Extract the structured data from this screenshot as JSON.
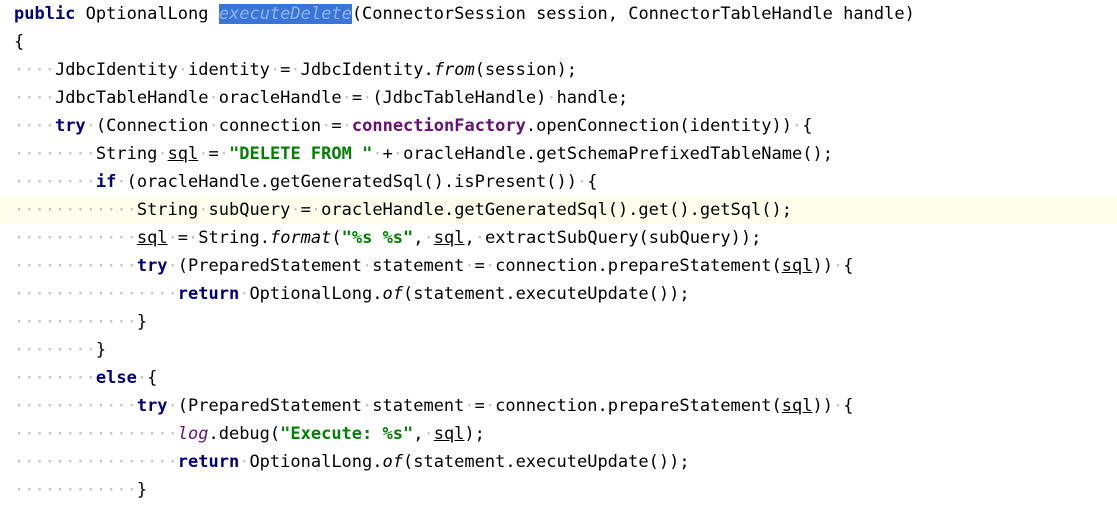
{
  "editor": {
    "language": "java",
    "selected_token": "executeDelete",
    "current_line_index": 7,
    "colors": {
      "background": "#ffffff",
      "keyword": "#000080",
      "string": "#008000",
      "field": "#660e7a",
      "whitespace_dot": "#c2c2c2",
      "selection": "#3875d7",
      "current_line": "#fefdeb"
    },
    "lines": [
      [
        {
          "t": "public",
          "c": "kw"
        },
        {
          "t": " ",
          "c": "ws-space"
        },
        {
          "t": "OptionalLong",
          "c": ""
        },
        {
          "t": " ",
          "c": "ws-space"
        },
        {
          "t": "executeDelete",
          "c": "sel-method"
        },
        {
          "t": "(ConnectorSession",
          "c": ""
        },
        {
          "t": " ",
          "c": "ws-space"
        },
        {
          "t": "session,",
          "c": ""
        },
        {
          "t": " ",
          "c": "ws-space"
        },
        {
          "t": "ConnectorTableHandle",
          "c": ""
        },
        {
          "t": " ",
          "c": "ws-space"
        },
        {
          "t": "handle)",
          "c": ""
        }
      ],
      [
        {
          "t": "{",
          "c": ""
        }
      ],
      [
        {
          "t": "····",
          "c": "ws"
        },
        {
          "t": "JdbcIdentity",
          "c": ""
        },
        {
          "t": "·",
          "c": "ws"
        },
        {
          "t": "identity",
          "c": ""
        },
        {
          "t": "·",
          "c": "ws"
        },
        {
          "t": "=",
          "c": ""
        },
        {
          "t": "·",
          "c": "ws"
        },
        {
          "t": "JdbcIdentity.",
          "c": ""
        },
        {
          "t": "from",
          "c": "static-call"
        },
        {
          "t": "(session);",
          "c": ""
        }
      ],
      [
        {
          "t": "····",
          "c": "ws"
        },
        {
          "t": "JdbcTableHandle",
          "c": ""
        },
        {
          "t": "·",
          "c": "ws"
        },
        {
          "t": "oracleHandle",
          "c": ""
        },
        {
          "t": "·",
          "c": "ws"
        },
        {
          "t": "=",
          "c": ""
        },
        {
          "t": "·",
          "c": "ws"
        },
        {
          "t": "(JdbcTableHandle)",
          "c": ""
        },
        {
          "t": "·",
          "c": "ws"
        },
        {
          "t": "handle;",
          "c": ""
        }
      ],
      [
        {
          "t": "····",
          "c": "ws"
        },
        {
          "t": "try",
          "c": "kw"
        },
        {
          "t": "·",
          "c": "ws"
        },
        {
          "t": "(Connection",
          "c": ""
        },
        {
          "t": "·",
          "c": "ws"
        },
        {
          "t": "connection",
          "c": ""
        },
        {
          "t": "·",
          "c": "ws"
        },
        {
          "t": "=",
          "c": ""
        },
        {
          "t": "·",
          "c": "ws"
        },
        {
          "t": "connectionFactory",
          "c": "field"
        },
        {
          "t": ".openConnection(identity))",
          "c": ""
        },
        {
          "t": "·",
          "c": "ws"
        },
        {
          "t": "{",
          "c": ""
        }
      ],
      [
        {
          "t": "········",
          "c": "ws"
        },
        {
          "t": "String",
          "c": ""
        },
        {
          "t": "·",
          "c": "ws"
        },
        {
          "t": "sql",
          "c": "ul"
        },
        {
          "t": "·",
          "c": "ws"
        },
        {
          "t": "=",
          "c": ""
        },
        {
          "t": "·",
          "c": "ws"
        },
        {
          "t": "\"DELETE FROM \"",
          "c": "str"
        },
        {
          "t": "·",
          "c": "ws"
        },
        {
          "t": "+",
          "c": ""
        },
        {
          "t": "·",
          "c": "ws"
        },
        {
          "t": "oracleHandle.getSchemaPrefixedTableName();",
          "c": ""
        }
      ],
      [
        {
          "t": "········",
          "c": "ws"
        },
        {
          "t": "if",
          "c": "kw"
        },
        {
          "t": "·",
          "c": "ws"
        },
        {
          "t": "(oracleHandle.getGeneratedSql().isPresent())",
          "c": ""
        },
        {
          "t": "·",
          "c": "ws"
        },
        {
          "t": "{",
          "c": ""
        }
      ],
      [
        {
          "t": "············",
          "c": "ws"
        },
        {
          "t": "String",
          "c": ""
        },
        {
          "t": "·",
          "c": "ws"
        },
        {
          "t": "subQuery",
          "c": ""
        },
        {
          "t": "·",
          "c": "ws"
        },
        {
          "t": "=",
          "c": ""
        },
        {
          "t": "·",
          "c": "ws"
        },
        {
          "t": "oracleHandle.getGeneratedSql().get().getSql();",
          "c": ""
        }
      ],
      [
        {
          "t": "············",
          "c": "ws"
        },
        {
          "t": "sql",
          "c": "ul"
        },
        {
          "t": "·",
          "c": "ws"
        },
        {
          "t": "=",
          "c": ""
        },
        {
          "t": "·",
          "c": "ws"
        },
        {
          "t": "String.",
          "c": ""
        },
        {
          "t": "format",
          "c": "static-call"
        },
        {
          "t": "(",
          "c": ""
        },
        {
          "t": "\"%s %s\"",
          "c": "str"
        },
        {
          "t": ",",
          "c": ""
        },
        {
          "t": "·",
          "c": "ws"
        },
        {
          "t": "sql",
          "c": "ul"
        },
        {
          "t": ",",
          "c": ""
        },
        {
          "t": "·",
          "c": "ws"
        },
        {
          "t": "extractSubQuery(subQuery));",
          "c": ""
        }
      ],
      [
        {
          "t": "············",
          "c": "ws"
        },
        {
          "t": "try",
          "c": "kw"
        },
        {
          "t": "·",
          "c": "ws"
        },
        {
          "t": "(PreparedStatement",
          "c": ""
        },
        {
          "t": "·",
          "c": "ws"
        },
        {
          "t": "statement",
          "c": ""
        },
        {
          "t": "·",
          "c": "ws"
        },
        {
          "t": "=",
          "c": ""
        },
        {
          "t": "·",
          "c": "ws"
        },
        {
          "t": "connection.prepareStatement(",
          "c": ""
        },
        {
          "t": "sql",
          "c": "ul"
        },
        {
          "t": "))",
          "c": ""
        },
        {
          "t": "·",
          "c": "ws"
        },
        {
          "t": "{",
          "c": ""
        }
      ],
      [
        {
          "t": "················",
          "c": "ws"
        },
        {
          "t": "return",
          "c": "kw"
        },
        {
          "t": "·",
          "c": "ws"
        },
        {
          "t": "OptionalLong.",
          "c": ""
        },
        {
          "t": "of",
          "c": "static-call"
        },
        {
          "t": "(statement.executeUpdate());",
          "c": ""
        }
      ],
      [
        {
          "t": "············",
          "c": "ws"
        },
        {
          "t": "}",
          "c": ""
        }
      ],
      [
        {
          "t": "········",
          "c": "ws"
        },
        {
          "t": "}",
          "c": ""
        }
      ],
      [
        {
          "t": "········",
          "c": "ws"
        },
        {
          "t": "else",
          "c": "kw"
        },
        {
          "t": "·",
          "c": "ws"
        },
        {
          "t": "{",
          "c": ""
        }
      ],
      [
        {
          "t": "············",
          "c": "ws"
        },
        {
          "t": "try",
          "c": "kw"
        },
        {
          "t": "·",
          "c": "ws"
        },
        {
          "t": "(PreparedStatement",
          "c": ""
        },
        {
          "t": "·",
          "c": "ws"
        },
        {
          "t": "statement",
          "c": ""
        },
        {
          "t": "·",
          "c": "ws"
        },
        {
          "t": "=",
          "c": ""
        },
        {
          "t": "·",
          "c": "ws"
        },
        {
          "t": "connection.prepareStatement(",
          "c": ""
        },
        {
          "t": "sql",
          "c": "ul"
        },
        {
          "t": "))",
          "c": ""
        },
        {
          "t": "·",
          "c": "ws"
        },
        {
          "t": "{",
          "c": ""
        }
      ],
      [
        {
          "t": "················",
          "c": "ws"
        },
        {
          "t": "log",
          "c": "static-field"
        },
        {
          "t": ".debug(",
          "c": ""
        },
        {
          "t": "\"Execute: %s\"",
          "c": "str"
        },
        {
          "t": ",",
          "c": ""
        },
        {
          "t": "·",
          "c": "ws"
        },
        {
          "t": "sql",
          "c": "ul"
        },
        {
          "t": ");",
          "c": ""
        }
      ],
      [
        {
          "t": "················",
          "c": "ws"
        },
        {
          "t": "return",
          "c": "kw"
        },
        {
          "t": "·",
          "c": "ws"
        },
        {
          "t": "OptionalLong.",
          "c": ""
        },
        {
          "t": "of",
          "c": "static-call"
        },
        {
          "t": "(statement.executeUpdate());",
          "c": ""
        }
      ],
      [
        {
          "t": "············",
          "c": "ws"
        },
        {
          "t": "}",
          "c": ""
        }
      ]
    ]
  }
}
